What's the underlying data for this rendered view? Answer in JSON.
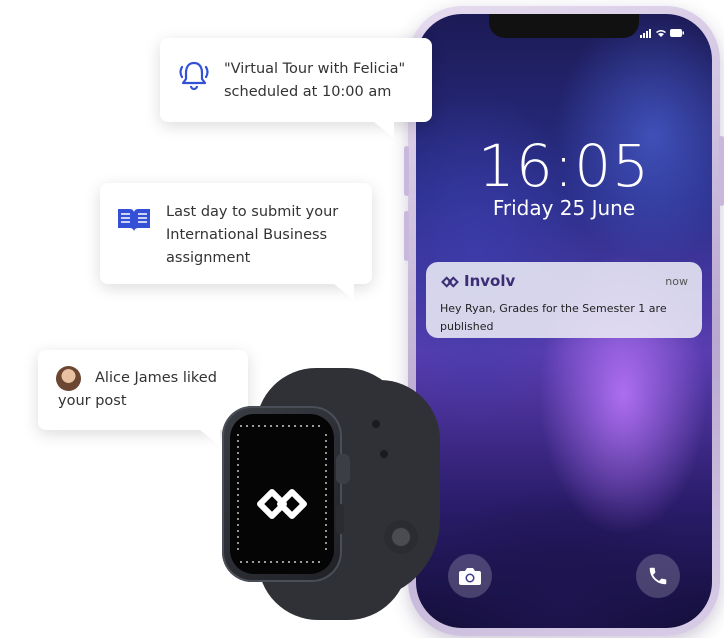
{
  "phone": {
    "time": "16:05",
    "date": "Friday 25 June",
    "notification": {
      "app_name": "Involv",
      "when": "now",
      "message": "Hey Ryan, Grades for the Semester 1 are published"
    },
    "quick_actions": [
      "camera-icon",
      "phone-icon"
    ]
  },
  "bubbles": {
    "tour": {
      "icon": "bell-icon",
      "text": "\"Virtual Tour with Felicia\" scheduled at 10:00 am"
    },
    "assignment": {
      "icon": "book-icon",
      "text": "Last day to submit your International Business assignment"
    },
    "like": {
      "icon": "avatar",
      "text": "Alice James liked your post"
    }
  },
  "colors": {
    "brand": "#3b2c74",
    "icon_blue": "#3350d6",
    "bubble_bg": "#ffffff"
  }
}
